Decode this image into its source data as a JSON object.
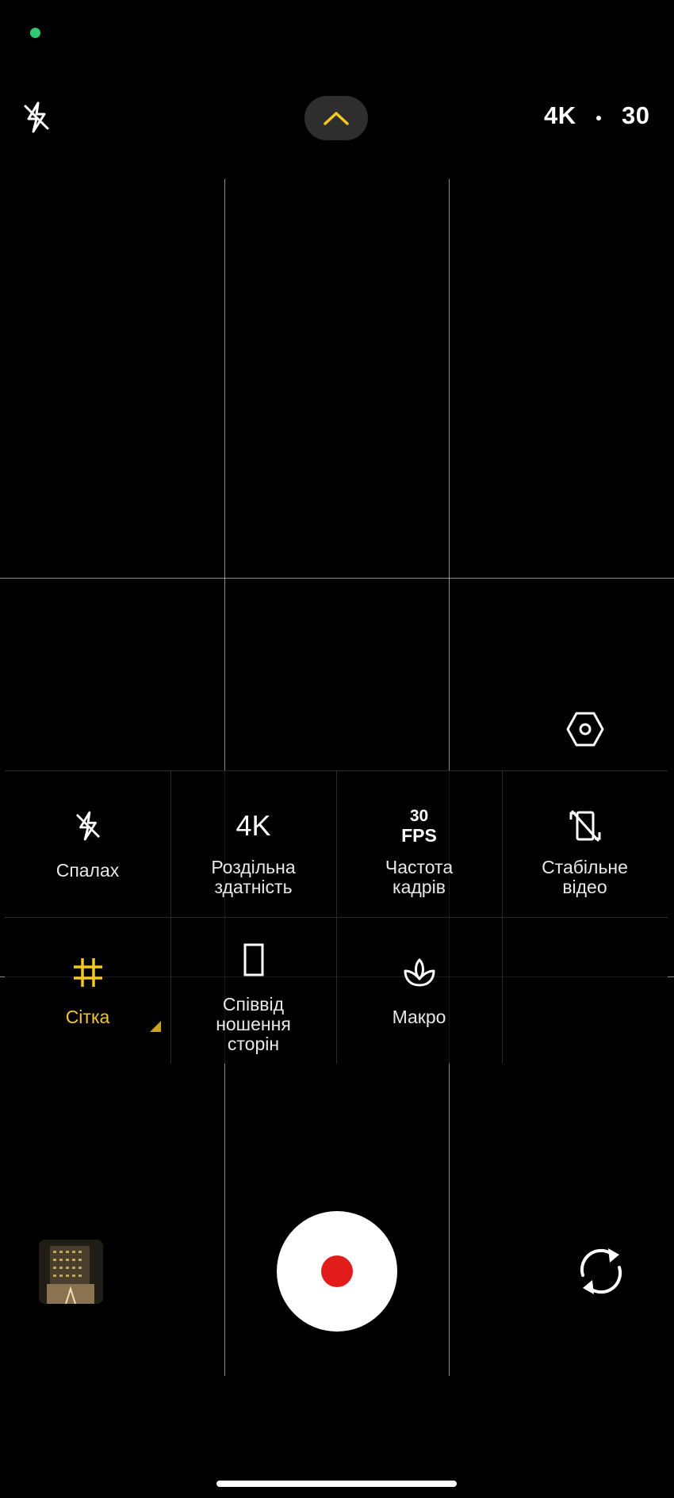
{
  "top_bar": {
    "resolution": "4K",
    "fps": "30"
  },
  "settings_panel": {
    "row1": [
      {
        "name": "flash",
        "icon": "flash-off-icon",
        "label": "Спалах"
      },
      {
        "name": "resolution",
        "icon_text": "4K",
        "label": "Роздільна\nздатність"
      },
      {
        "name": "frame-rate",
        "icon_text_top": "30",
        "icon_text_bottom": "FPS",
        "label": "Частота\nкадрів"
      },
      {
        "name": "stable-video",
        "icon": "stabilization-icon",
        "label": "Стабільне\nвідео"
      }
    ],
    "row2": [
      {
        "name": "grid",
        "icon": "grid-icon",
        "label": "Сітка",
        "active": true
      },
      {
        "name": "aspect-ratio",
        "icon": "aspect-ratio-icon",
        "label": "Співвід\nношення\nсторін"
      },
      {
        "name": "macro",
        "icon": "macro-flower-icon",
        "label": "Макро"
      }
    ]
  },
  "colors": {
    "accent": "#f5c722",
    "record": "#e21b1b",
    "status_dot": "#2ecc71"
  }
}
